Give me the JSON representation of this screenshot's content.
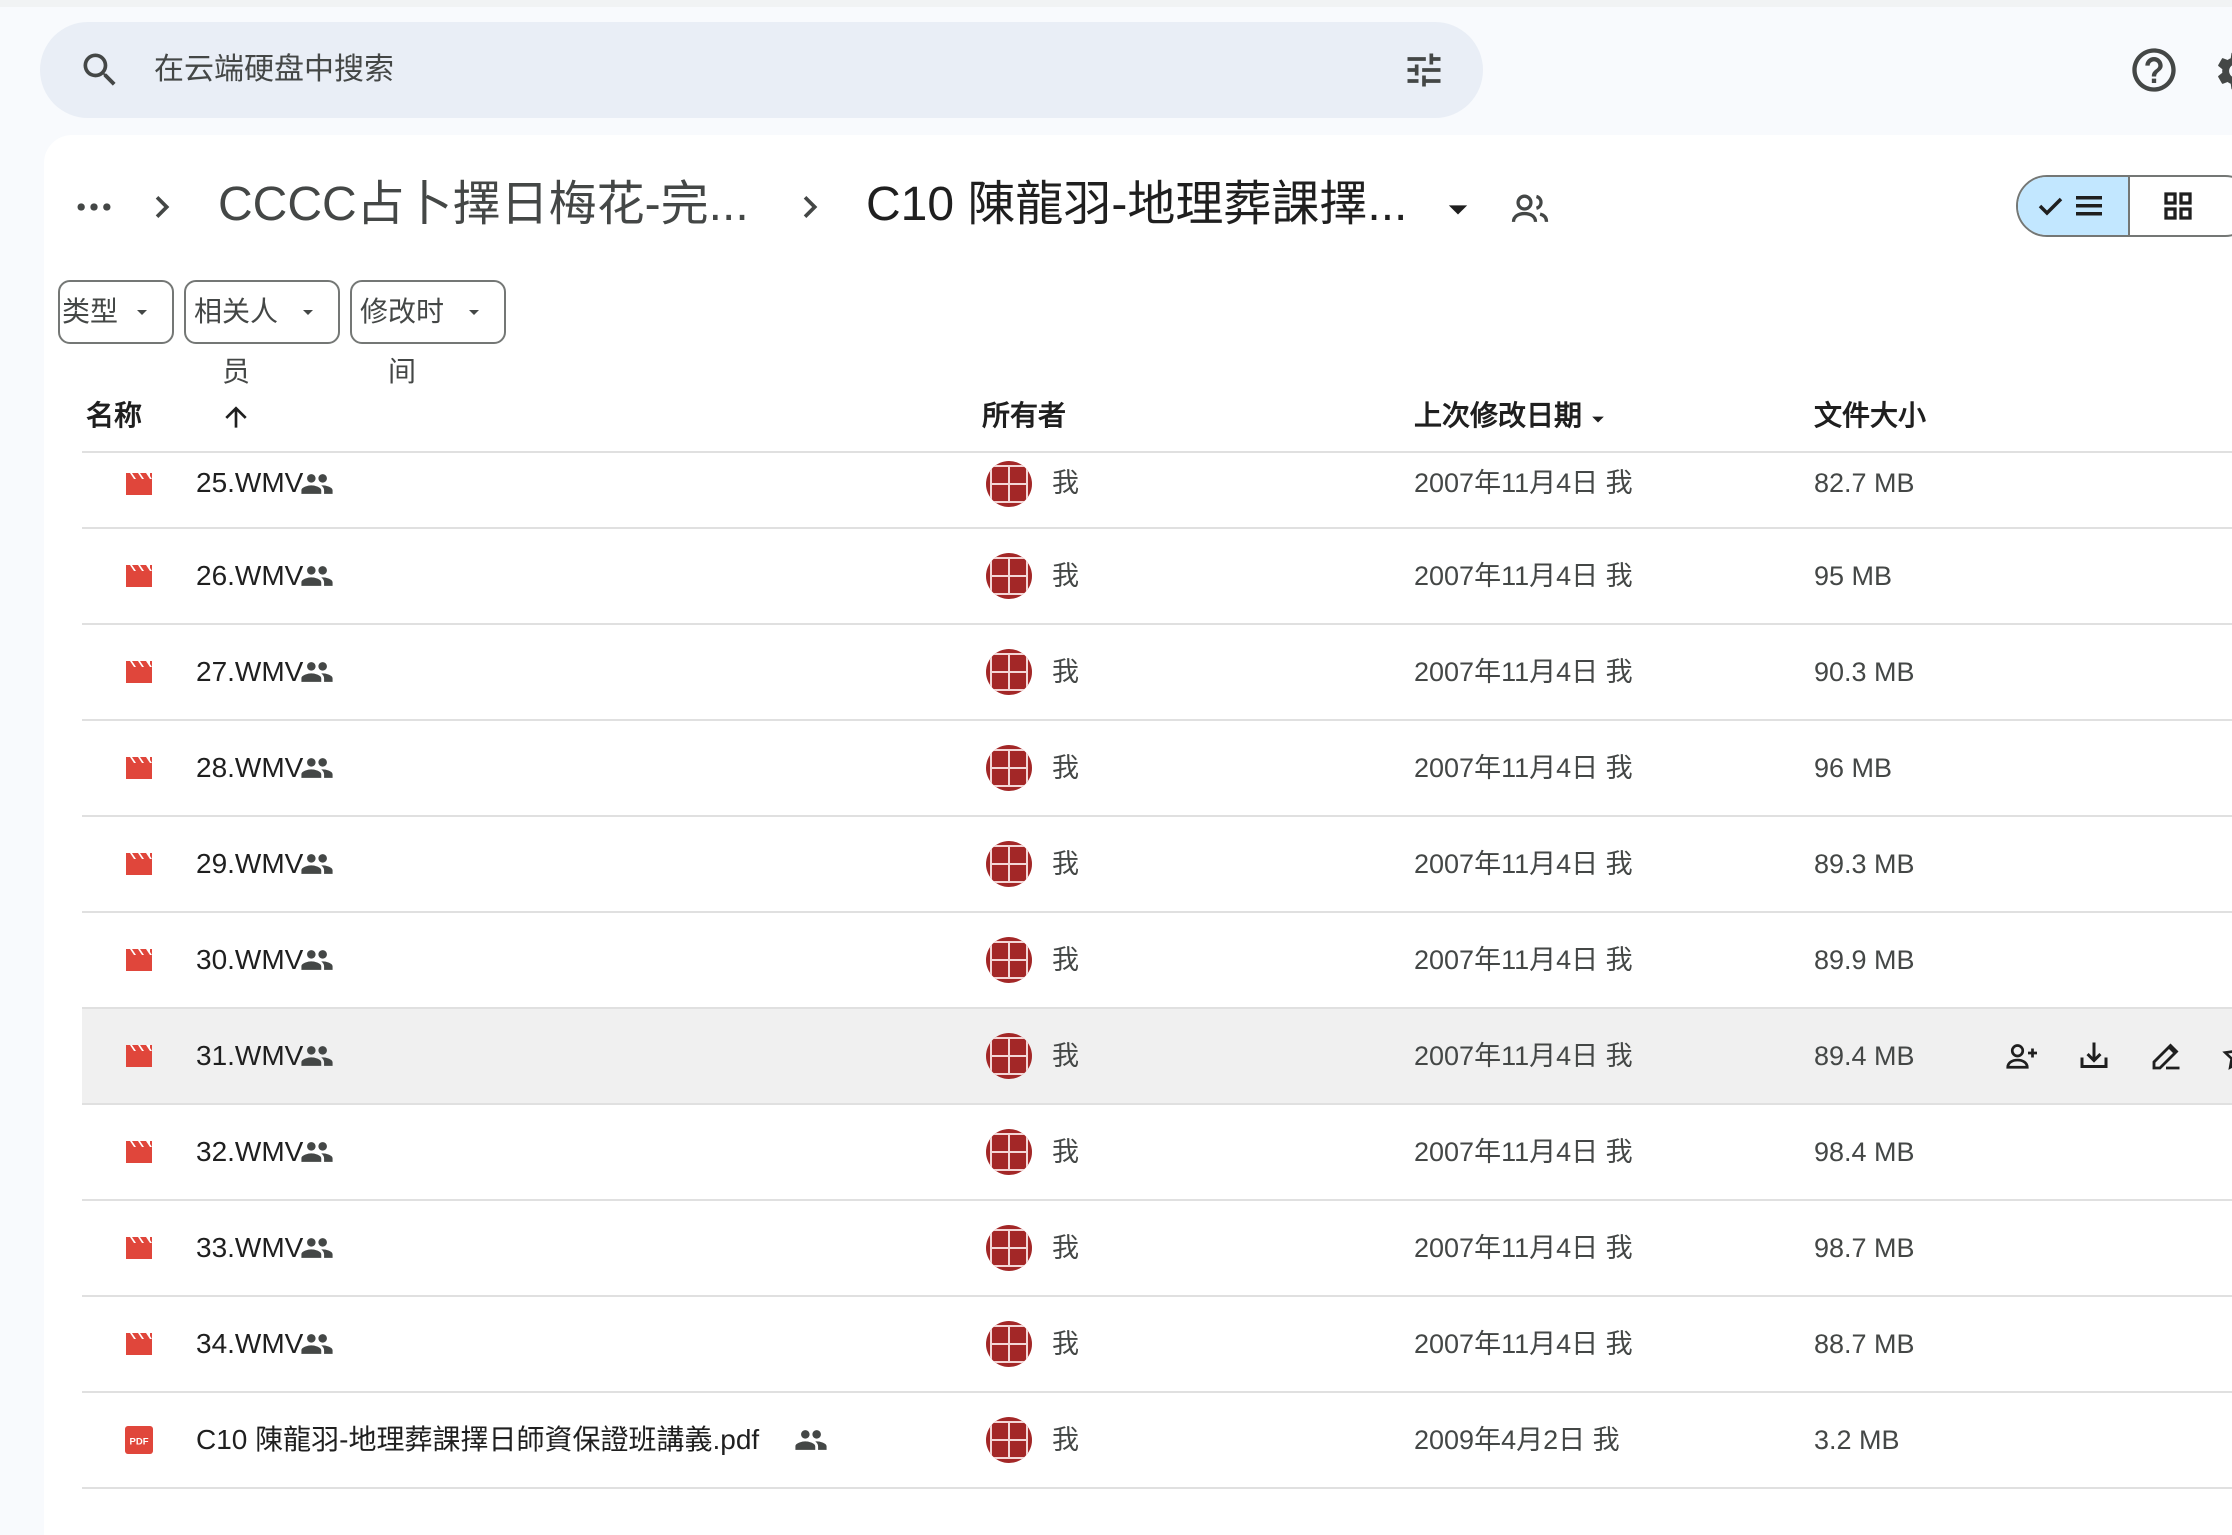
{
  "search": {
    "placeholder": "在云端硬盘中搜索"
  },
  "breadcrumb": {
    "parent": "CCCC占卜擇日梅花-完...",
    "current": "C10 陳龍羽-地理葬課擇..."
  },
  "filters": [
    {
      "label": "类型"
    },
    {
      "label": "相关人员"
    },
    {
      "label": "修改时间"
    }
  ],
  "columns": {
    "name": "名称",
    "owner": "所有者",
    "modified": "上次修改日期",
    "size": "文件大小"
  },
  "files": [
    {
      "name": "25.WMV",
      "type": "video",
      "owner": "我",
      "modified": "2007年11月4日 我",
      "size": "82.7 MB"
    },
    {
      "name": "26.WMV",
      "type": "video",
      "owner": "我",
      "modified": "2007年11月4日 我",
      "size": "95 MB"
    },
    {
      "name": "27.WMV",
      "type": "video",
      "owner": "我",
      "modified": "2007年11月4日 我",
      "size": "90.3 MB"
    },
    {
      "name": "28.WMV",
      "type": "video",
      "owner": "我",
      "modified": "2007年11月4日 我",
      "size": "96 MB"
    },
    {
      "name": "29.WMV",
      "type": "video",
      "owner": "我",
      "modified": "2007年11月4日 我",
      "size": "89.3 MB"
    },
    {
      "name": "30.WMV",
      "type": "video",
      "owner": "我",
      "modified": "2007年11月4日 我",
      "size": "89.9 MB"
    },
    {
      "name": "31.WMV",
      "type": "video",
      "owner": "我",
      "modified": "2007年11月4日 我",
      "size": "89.4 MB",
      "hovered": true
    },
    {
      "name": "32.WMV",
      "type": "video",
      "owner": "我",
      "modified": "2007年11月4日 我",
      "size": "98.4 MB"
    },
    {
      "name": "33.WMV",
      "type": "video",
      "owner": "我",
      "modified": "2007年11月4日 我",
      "size": "98.7 MB"
    },
    {
      "name": "34.WMV",
      "type": "video",
      "owner": "我",
      "modified": "2007年11月4日 我",
      "size": "88.7 MB"
    },
    {
      "name": "C10 陳龍羽-地理葬課擇日師資保證班講義.pdf",
      "type": "pdf",
      "owner": "我",
      "modified": "2009年4月2日 我",
      "size": "3.2 MB"
    }
  ],
  "icons": {
    "video": "video-clapper-icon",
    "pdf": "pdf-icon",
    "pdf_badge_text": "PDF",
    "shared": "people-icon",
    "row_actions": [
      "share-icon",
      "download-icon",
      "rename-icon",
      "star-icon"
    ]
  },
  "colors": {
    "accent": "#c2e7ff",
    "file_red": "#e0463b",
    "search_bg": "#e9eef6"
  }
}
